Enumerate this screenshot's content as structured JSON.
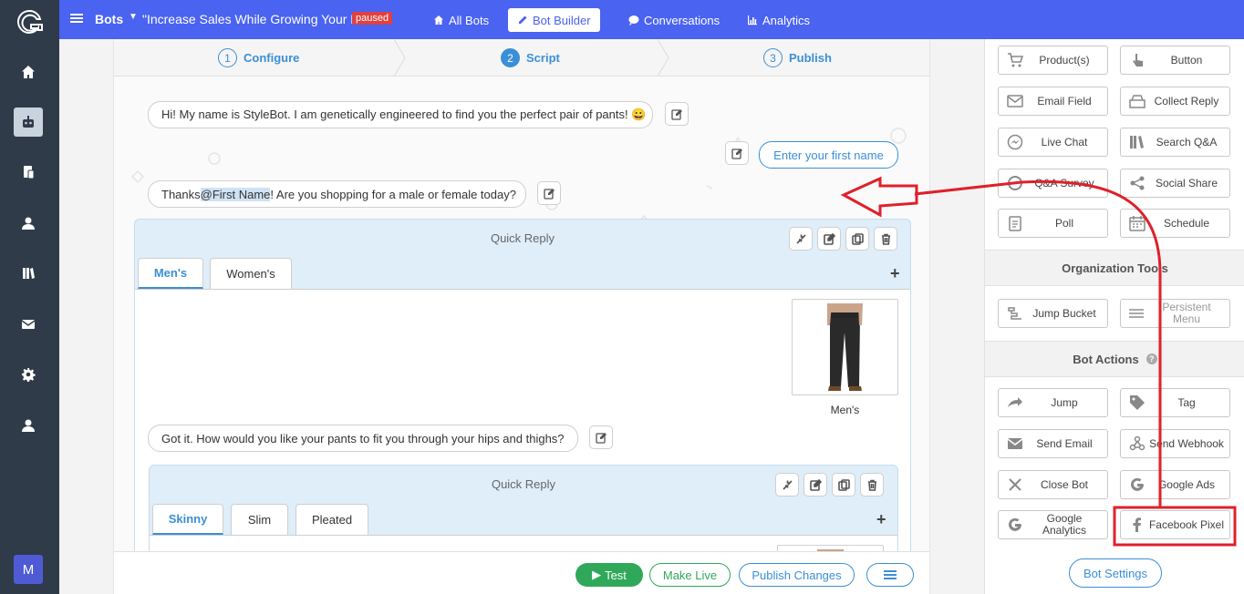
{
  "rail": {
    "brand_letter": "M"
  },
  "topbar": {
    "bots_label": "Bots",
    "bot_name": "\"Increase Sales While Growing Your List\"",
    "status_badge": "paused",
    "nav": [
      {
        "label": "All Bots",
        "icon": "home-icon"
      },
      {
        "label": "Bot Builder",
        "icon": "pencil-icon",
        "active": true
      },
      {
        "label": "Conversations",
        "icon": "chat-icon"
      },
      {
        "label": "Analytics",
        "icon": "bar-chart-icon"
      }
    ]
  },
  "steps": [
    {
      "num": "1",
      "label": "Configure"
    },
    {
      "num": "2",
      "label": "Script",
      "active": true
    },
    {
      "num": "3",
      "label": "Publish"
    }
  ],
  "script": {
    "msg1": "Hi! My name is StyleBot. I am genetically engineered to find you the perfect pair of pants! 😀",
    "user_input_placeholder": "Enter your first name",
    "msg2_pre": "Thanks ",
    "msg2_mention": "@First Name",
    "msg2_post": "! Are you shopping for a male or female today?",
    "quick_reply_1": {
      "title": "Quick Reply",
      "tabs": [
        "Men's",
        "Women's"
      ],
      "card_label": "Men's"
    },
    "msg3": "Got it. How would you like your pants to fit you through your hips and thighs?",
    "quick_reply_2": {
      "title": "Quick Reply",
      "tabs": [
        "Skinny",
        "Slim",
        "Pleated"
      ]
    }
  },
  "bottom": {
    "test": "Test",
    "make_live": "Make Live",
    "publish": "Publish Changes"
  },
  "panel": {
    "content_buttons": [
      {
        "label": "Product(s)",
        "icon": "cart-icon"
      },
      {
        "label": "Button",
        "icon": "pointer-icon"
      },
      {
        "label": "Email Field",
        "icon": "envelope-icon"
      },
      {
        "label": "Collect Reply",
        "icon": "inbox-icon"
      },
      {
        "label": "Live Chat",
        "icon": "messenger-icon"
      },
      {
        "label": "Search Q&A",
        "icon": "books-icon"
      },
      {
        "label": "Q&A Survey",
        "icon": "survey-icon"
      },
      {
        "label": "Social Share",
        "icon": "share-icon"
      },
      {
        "label": "Poll",
        "icon": "clipboard-icon"
      },
      {
        "label": "Schedule",
        "icon": "calendar-icon"
      }
    ],
    "org_title": "Organization Tools",
    "org_buttons": [
      {
        "label": "Jump Bucket",
        "icon": "bucket-icon"
      },
      {
        "label": "Persistent Menu",
        "icon": "menu-icon"
      }
    ],
    "actions_title": "Bot Actions",
    "action_buttons": [
      {
        "label": "Jump",
        "icon": "arrow-right-icon"
      },
      {
        "label": "Tag",
        "icon": "tag-icon"
      },
      {
        "label": "Send Email",
        "icon": "envelope-icon"
      },
      {
        "label": "Send Webhook",
        "icon": "webhook-icon"
      },
      {
        "label": "Close Bot",
        "icon": "close-icon"
      },
      {
        "label": "Google Ads",
        "icon": "google-icon"
      },
      {
        "label": "Google Analytics",
        "icon": "google-icon"
      },
      {
        "label": "Facebook Pixel",
        "icon": "facebook-icon"
      }
    ],
    "settings_label": "Bot Settings"
  },
  "colors": {
    "primary": "#4a63f0",
    "accent": "#3b8fd6",
    "success": "#2fa85a",
    "annotation": "#e0202a"
  }
}
